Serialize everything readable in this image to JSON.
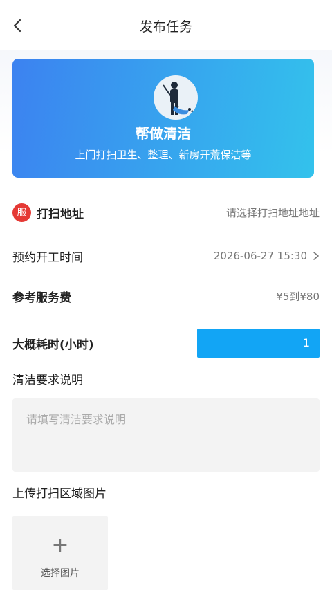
{
  "header": {
    "title": "发布任务"
  },
  "banner": {
    "title": "帮做清洁",
    "subtitle": "上门打扫卫生、整理、新房开荒保洁等"
  },
  "form": {
    "address": {
      "badge": "服",
      "label": "打扫地址",
      "placeholder": "请选择打扫地址地址"
    },
    "schedule": {
      "label": "预约开工时间",
      "value": "2026-06-27 15:30"
    },
    "fee": {
      "label": "参考服务费",
      "value": "¥5到¥80"
    },
    "hours": {
      "label": "大概耗时(小时)",
      "value": "1"
    },
    "description": {
      "label": "清洁要求说明",
      "placeholder": "请填写清洁要求说明"
    },
    "upload": {
      "label": "上传打扫区域图片",
      "button_label": "选择图片",
      "plus": "+"
    }
  },
  "colors": {
    "accent": "#12a5f5",
    "badge": "#e53935",
    "banner_start": "#3c82f0",
    "banner_end": "#33c2ec"
  }
}
